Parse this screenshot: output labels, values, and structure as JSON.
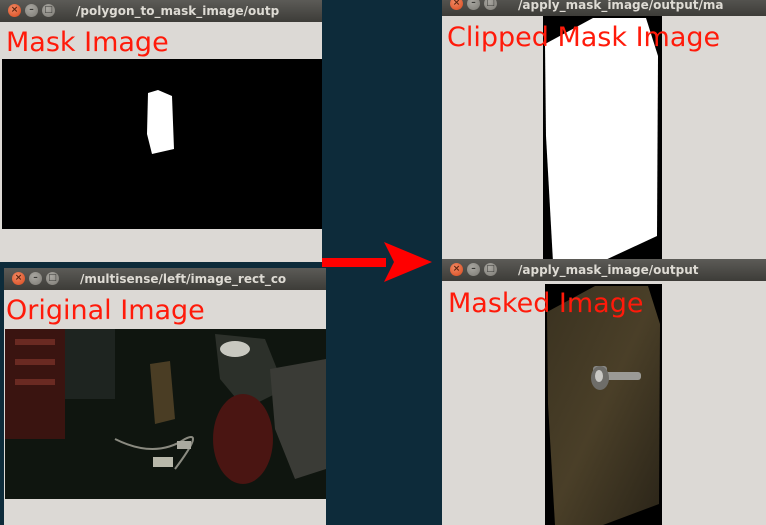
{
  "windows": {
    "mask": {
      "title": "/polygon_to_mask_image/outp",
      "label": "Mask Image"
    },
    "original": {
      "title": "/multisense/left/image_rect_co",
      "label": "Original Image"
    },
    "clipped": {
      "title": "/apply_mask_image/output/ma",
      "label": "Clipped Mask Image"
    },
    "masked": {
      "title": "/apply_mask_image/output",
      "label": "Masked Image"
    }
  },
  "colors": {
    "desktop": "#0d2b3a",
    "label": "#ff1a0a",
    "arrow": "#ff0000",
    "window_bg": "#dcd9d5"
  },
  "icons": [
    "close-icon",
    "minimize-icon",
    "maximize-icon",
    "arrow-right-icon"
  ]
}
